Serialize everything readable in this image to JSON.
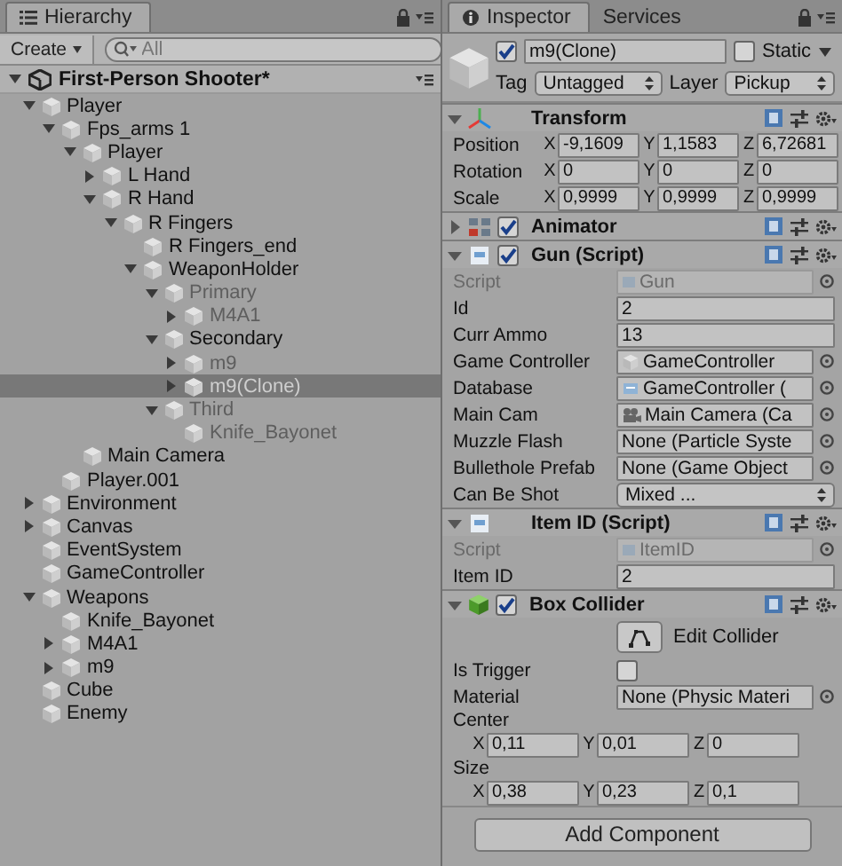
{
  "hierarchy": {
    "tab": {
      "label": "Hierarchy",
      "selected": true
    },
    "create_button": "Create",
    "search": {
      "placeholder": "All"
    },
    "scene": {
      "name": "First-Person Shooter*",
      "expanded": true
    },
    "tree": [
      {
        "name": "Player",
        "kind": "group",
        "expanded": true,
        "active": true,
        "selected": false,
        "children": [
          {
            "name": "Fps_arms 1",
            "kind": "group",
            "expanded": true,
            "active": true,
            "selected": false,
            "children": [
              {
                "name": "Player",
                "kind": "group",
                "expanded": true,
                "active": true,
                "selected": false,
                "children": [
                  {
                    "name": "L Hand",
                    "kind": "group",
                    "expanded": false,
                    "active": true,
                    "selected": false
                  },
                  {
                    "name": "R Hand",
                    "kind": "group",
                    "expanded": true,
                    "active": true,
                    "selected": false,
                    "children": [
                      {
                        "name": "R Fingers",
                        "kind": "group",
                        "expanded": true,
                        "active": true,
                        "selected": false,
                        "children": [
                          {
                            "name": "R Fingers_end",
                            "kind": "leaf",
                            "active": true,
                            "selected": false
                          },
                          {
                            "name": "WeaponHolder",
                            "kind": "group",
                            "expanded": true,
                            "active": true,
                            "selected": false,
                            "children": [
                              {
                                "name": "Primary",
                                "kind": "group",
                                "expanded": true,
                                "active": false,
                                "selected": false,
                                "children": [
                                  {
                                    "name": "M4A1",
                                    "kind": "group",
                                    "expanded": false,
                                    "active": false,
                                    "selected": false
                                  }
                                ]
                              },
                              {
                                "name": "Secondary",
                                "kind": "group",
                                "expanded": true,
                                "active": true,
                                "selected": false,
                                "children": [
                                  {
                                    "name": "m9",
                                    "kind": "group",
                                    "expanded": false,
                                    "active": false,
                                    "selected": false
                                  },
                                  {
                                    "name": "m9(Clone)",
                                    "kind": "group",
                                    "expanded": false,
                                    "active": false,
                                    "selected": true
                                  }
                                ]
                              },
                              {
                                "name": "Third",
                                "kind": "group",
                                "expanded": true,
                                "active": false,
                                "selected": false,
                                "children": [
                                  {
                                    "name": "Knife_Bayonet",
                                    "kind": "leaf",
                                    "active": false,
                                    "selected": false
                                  }
                                ]
                              }
                            ]
                          }
                        ]
                      }
                    ]
                  }
                ]
              },
              {
                "name": "Main Camera",
                "kind": "leaf",
                "active": true,
                "selected": false
              }
            ]
          },
          {
            "name": "Player.001",
            "kind": "leaf",
            "active": true,
            "selected": false
          }
        ]
      },
      {
        "name": "Environment",
        "kind": "group",
        "expanded": false,
        "active": true,
        "selected": false
      },
      {
        "name": "Canvas",
        "kind": "group",
        "expanded": false,
        "active": true,
        "selected": false
      },
      {
        "name": "EventSystem",
        "kind": "leaf",
        "active": true,
        "selected": false
      },
      {
        "name": "GameController",
        "kind": "leaf",
        "active": true,
        "selected": false
      },
      {
        "name": "Weapons",
        "kind": "group",
        "expanded": true,
        "active": true,
        "selected": false,
        "children": [
          {
            "name": "Knife_Bayonet",
            "kind": "leaf",
            "active": true,
            "selected": false
          },
          {
            "name": "M4A1",
            "kind": "group",
            "expanded": false,
            "active": true,
            "selected": false
          },
          {
            "name": "m9",
            "kind": "group",
            "expanded": false,
            "active": true,
            "selected": false
          }
        ]
      },
      {
        "name": "Cube",
        "kind": "leaf",
        "active": true,
        "selected": false
      },
      {
        "name": "Enemy",
        "kind": "leaf",
        "active": true,
        "selected": false
      }
    ]
  },
  "inspector": {
    "tabs": [
      {
        "label": "Inspector",
        "selected": true
      },
      {
        "label": "Services",
        "selected": false
      }
    ],
    "object": {
      "active": true,
      "name": "m9(Clone)",
      "static": false,
      "static_label": "Static",
      "tag_label": "Tag",
      "tag": "Untagged",
      "layer_label": "Layer",
      "layer": "Pickup"
    },
    "components": [
      {
        "name": "Transform",
        "kind": "transform",
        "expanded": true,
        "fields": [
          {
            "kind": "vector3",
            "label": "Position",
            "values": [
              {
                "axis": "X",
                "value": "-9,1609"
              },
              {
                "axis": "Y",
                "value": "1,1583"
              },
              {
                "axis": "Z",
                "value": "6,72681"
              }
            ]
          },
          {
            "kind": "vector3",
            "label": "Rotation",
            "values": [
              {
                "axis": "X",
                "value": "0"
              },
              {
                "axis": "Y",
                "value": "0"
              },
              {
                "axis": "Z",
                "value": "0"
              }
            ]
          },
          {
            "kind": "vector3",
            "label": "Scale",
            "values": [
              {
                "axis": "X",
                "value": "0,9999"
              },
              {
                "axis": "Y",
                "value": "0,9999"
              },
              {
                "axis": "Z",
                "value": "0,9999"
              }
            ]
          }
        ]
      },
      {
        "name": "Animator",
        "kind": "animator",
        "enabled": true,
        "expanded": false
      },
      {
        "name": "Gun (Script)",
        "kind": "script",
        "enabled": true,
        "expanded": true,
        "fields": [
          {
            "kind": "script",
            "label": "Script",
            "value": "Gun"
          },
          {
            "kind": "text",
            "label": "Id",
            "value": "2"
          },
          {
            "kind": "text",
            "label": "Curr Ammo",
            "value": "13"
          },
          {
            "kind": "gameobject_ref",
            "label": "Game Controller",
            "value": "GameController"
          },
          {
            "kind": "script_ref",
            "label": "Database",
            "value": "GameController ("
          },
          {
            "kind": "camera_ref",
            "label": "Main Cam",
            "value": "Main Camera (Ca"
          },
          {
            "kind": "object",
            "label": "Muzzle Flash",
            "value": "None (Particle Syste"
          },
          {
            "kind": "object",
            "label": "Bullethole Prefab",
            "value": "None (Game Object"
          },
          {
            "kind": "dropdown",
            "label": "Can Be Shot",
            "value": "Mixed ..."
          }
        ]
      },
      {
        "name": "Item ID (Script)",
        "kind": "script",
        "expanded": true,
        "fields": [
          {
            "kind": "script",
            "label": "Script",
            "value": "ItemID"
          },
          {
            "kind": "text",
            "label": "Item ID",
            "value": "2"
          }
        ]
      },
      {
        "name": "Box Collider",
        "kind": "collider",
        "enabled": true,
        "expanded": true,
        "fields": [
          {
            "kind": "button",
            "label": "Edit Collider"
          },
          {
            "kind": "checkbox",
            "label": "Is Trigger",
            "checked": false
          },
          {
            "kind": "object",
            "label": "Material",
            "value": "None (Physic Materi"
          },
          {
            "kind": "vector3_block",
            "label": "Center",
            "values": [
              {
                "axis": "X",
                "value": "0,11"
              },
              {
                "axis": "Y",
                "value": "0,01"
              },
              {
                "axis": "Z",
                "value": "0"
              }
            ]
          },
          {
            "kind": "vector3_block",
            "label": "Size",
            "values": [
              {
                "axis": "X",
                "value": "0,38"
              },
              {
                "axis": "Y",
                "value": "0,23"
              },
              {
                "axis": "Z",
                "value": "0,1"
              }
            ]
          }
        ]
      }
    ],
    "add_button": "Add Component"
  }
}
